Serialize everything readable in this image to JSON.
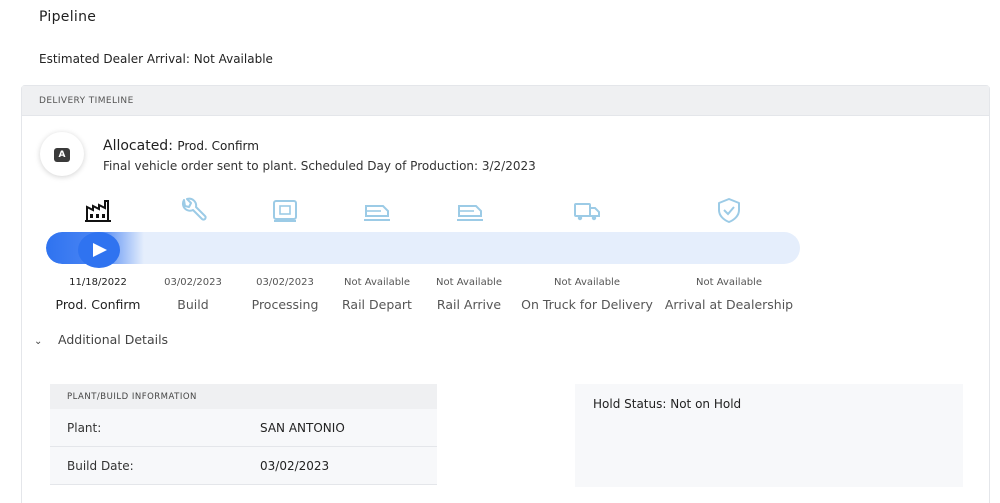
{
  "page": {
    "title": "Pipeline",
    "eda_label": "Estimated Dealer Arrival:",
    "eda_value": "Not Available"
  },
  "timeline": {
    "header": "DELIVERY TIMELINE",
    "badge_letter": "A",
    "status_main": "Allocated:",
    "status_sub": "Prod. Confirm",
    "description": "Final vehicle order sent to plant. Scheduled Day of Production: 3/2/2023",
    "progress": 0.13,
    "steps": [
      {
        "label": "Prod. Confirm",
        "date": "11/18/2022",
        "icon": "factory-icon"
      },
      {
        "label": "Build",
        "date": "03/02/2023",
        "icon": "wrench-icon"
      },
      {
        "label": "Processing",
        "date": "03/02/2023",
        "icon": "processing-icon"
      },
      {
        "label": "Rail Depart",
        "date": "Not Available",
        "icon": "rail-depart-icon"
      },
      {
        "label": "Rail Arrive",
        "date": "Not Available",
        "icon": "rail-arrive-icon"
      },
      {
        "label": "On Truck for Delivery",
        "date": "Not Available",
        "icon": "truck-icon"
      },
      {
        "label": "Arrival at Dealership",
        "date": "Not Available",
        "icon": "shield-check-icon"
      }
    ],
    "details_toggle": "Additional Details"
  },
  "plant_info": {
    "header": "PLANT/BUILD INFORMATION",
    "rows": [
      {
        "key": "Plant:",
        "value": "SAN ANTONIO"
      },
      {
        "key": "Build Date:",
        "value": "03/02/2023"
      }
    ]
  },
  "hold": {
    "text": "Hold Status: Not on Hold"
  },
  "colors": {
    "accent": "#2f73f0",
    "icon_inactive": "#9ccbe6",
    "track_bg": "#e5eefc"
  }
}
